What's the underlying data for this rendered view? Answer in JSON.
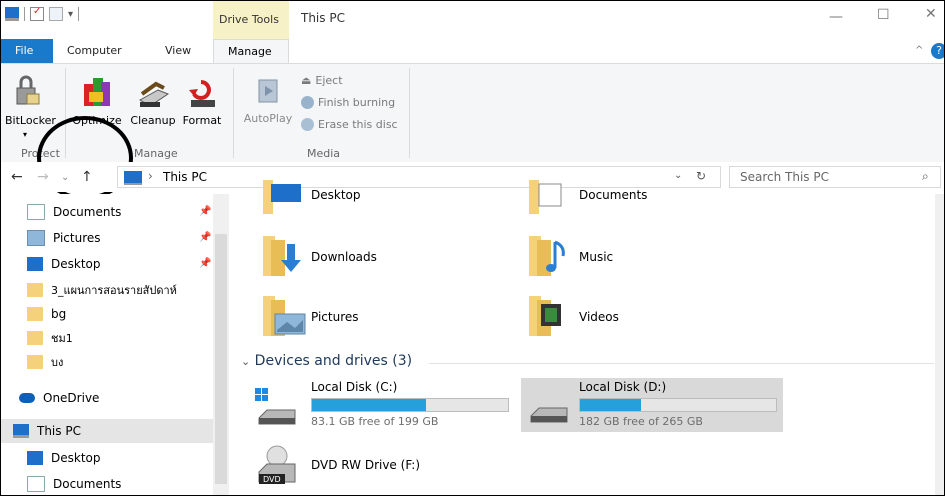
{
  "window": {
    "title": "This PC",
    "context_tab_group": "Drive Tools"
  },
  "tabs": {
    "file": "File",
    "computer": "Computer",
    "view": "View",
    "manage": "Manage"
  },
  "ribbon": {
    "bitlocker": "BitLocker",
    "optimize": "Optimize",
    "cleanup": "Cleanup",
    "format": "Format",
    "autoplay": "AutoPlay",
    "eject": "Eject",
    "finish_burning": "Finish burning",
    "erase_disc": "Erase this disc",
    "groups": {
      "protect": "Protect",
      "manage": "Manage",
      "media": "Media"
    }
  },
  "address": {
    "path": "This PC",
    "search_placeholder": "Search This PC"
  },
  "nav_pane": {
    "items": [
      "Documents",
      "Pictures",
      "Desktop",
      "3_แผนการสอนรายสัปดาห์",
      "bg",
      "ชม1",
      "บง",
      "OneDrive",
      "This PC",
      "Desktop",
      "Documents"
    ]
  },
  "folders": [
    {
      "name": "Desktop"
    },
    {
      "name": "Documents"
    },
    {
      "name": "Downloads"
    },
    {
      "name": "Music"
    },
    {
      "name": "Pictures"
    },
    {
      "name": "Videos"
    }
  ],
  "devices": {
    "header": "Devices and drives (3)",
    "drives": [
      {
        "name": "Local Disk (C:)",
        "free": "83.1 GB free of 199 GB",
        "used_fraction": 0.58
      },
      {
        "name": "Local Disk (D:)",
        "free": "182 GB free of 265 GB",
        "used_fraction": 0.31
      },
      {
        "name": "DVD RW Drive (F:)"
      }
    ]
  },
  "colors": {
    "accent": "#1979ca",
    "drive_bar": "#26a0da",
    "context_tab": "#f7f1c8"
  }
}
